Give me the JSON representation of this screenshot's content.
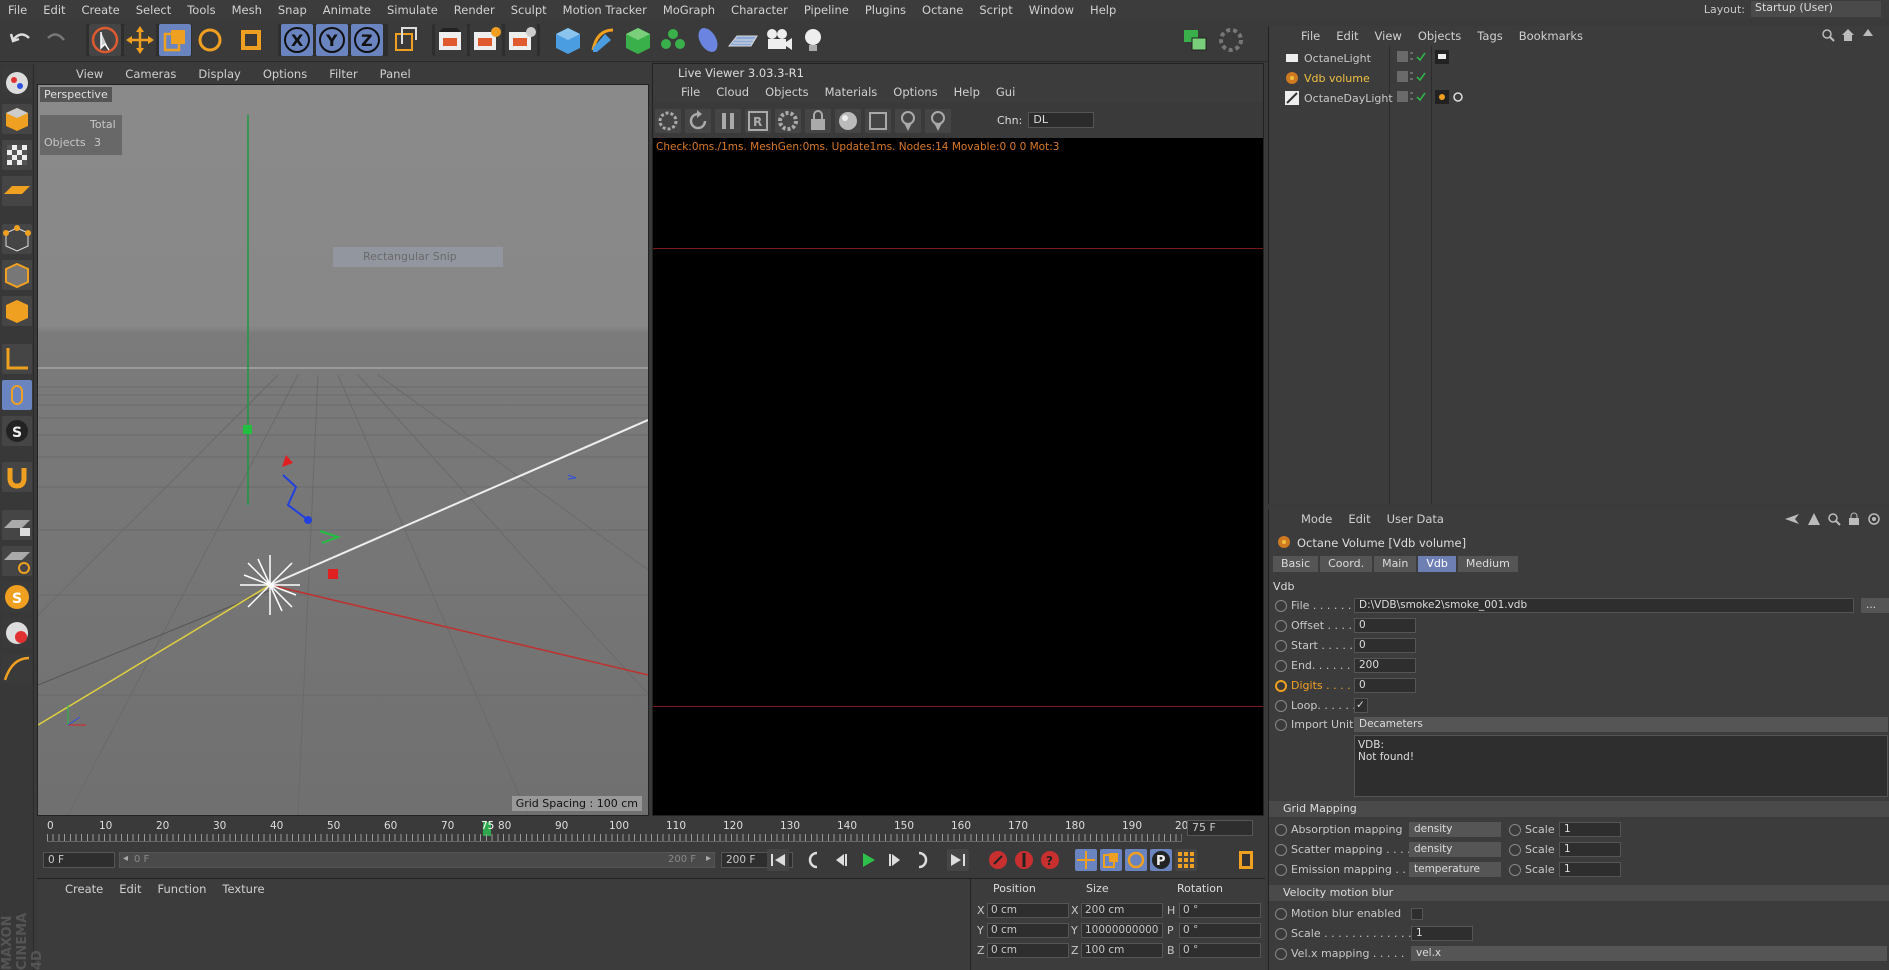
{
  "menubar": {
    "items": [
      "File",
      "Edit",
      "Create",
      "Select",
      "Tools",
      "Mesh",
      "Snap",
      "Animate",
      "Simulate",
      "Render",
      "Sculpt",
      "Motion Tracker",
      "MoGraph",
      "Character",
      "Pipeline",
      "Plugins",
      "Octane",
      "Script",
      "Window",
      "Help"
    ],
    "layout_label": "Layout:",
    "layout_value": "Startup (User)"
  },
  "viewport": {
    "menu": [
      "View",
      "Cameras",
      "Display",
      "Options",
      "Filter",
      "Panel"
    ],
    "name": "Perspective",
    "hud_total": "Total",
    "hud_objects_label": "Objects",
    "hud_objects_value": "3",
    "grid_spacing": "Grid Spacing : 100 cm",
    "snip_label": "Rectangular Snip"
  },
  "live_viewer": {
    "title": "Live Viewer 3.03.3-R1",
    "menu": [
      "File",
      "Cloud",
      "Objects",
      "Materials",
      "Options",
      "Help",
      "Gui"
    ],
    "chn_label": "Chn:",
    "chn_value": "DL",
    "status": "Check:0ms./1ms. MeshGen:0ms. Update1ms. Nodes:14 Movable:0  0 0 Mot:3"
  },
  "object_manager": {
    "menu": [
      "File",
      "Edit",
      "View",
      "Objects",
      "Tags",
      "Bookmarks"
    ],
    "objects": [
      {
        "name": "OctaneLight",
        "color": "#c8c8c8"
      },
      {
        "name": "Vdb volume",
        "color": "#f0c040"
      },
      {
        "name": "OctaneDayLight",
        "color": "#c8c8c8"
      }
    ]
  },
  "attributes": {
    "menu": [
      "Mode",
      "Edit",
      "User Data"
    ],
    "title": "Octane Volume [Vdb volume]",
    "tabs": [
      "Basic",
      "Coord.",
      "Main",
      "Vdb",
      "Medium"
    ],
    "active_tab": "Vdb",
    "section_vdb": "Vdb",
    "file_label": "File . . . . . . .",
    "file_value": "D:\\VDB\\smoke2\\smoke_001.vdb",
    "offset_label": "Offset . . . . .",
    "offset_value": "0",
    "start_label": "Start . . . . . .",
    "start_value": "0",
    "end_label": "End. . . . . . .",
    "end_value": "200",
    "digits_label": "Digits . . . . .",
    "digits_value": "0",
    "loop_label": "Loop. . . . . .",
    "loop_value": "✓",
    "import_unit_label": "Import Unit",
    "import_unit_value": "Decameters",
    "vdb_info_line1": "VDB:",
    "vdb_info_line2": "Not found!",
    "grid_mapping_label": "Grid Mapping",
    "absorption_label": "Absorption mapping",
    "absorption_value": "density",
    "scatter_label": "Scatter mapping . . . .",
    "scatter_value": "density",
    "emission_label": "Emission mapping . .",
    "emission_value": "temperature",
    "scale_label": "Scale",
    "absorption_scale": "1",
    "scatter_scale": "1",
    "emission_scale": "1",
    "velocity_label": "Velocity motion blur",
    "motion_blur_label": "Motion blur enabled",
    "vscale_label": "Scale . . . . . . . . . . . . .",
    "vscale_value": "1",
    "velx_label": "Vel.x mapping . . . . .",
    "velx_value": "vel.x"
  },
  "timeline": {
    "ticks": [
      "0",
      "10",
      "20",
      "30",
      "40",
      "50",
      "60",
      "70",
      "75",
      "80",
      "90",
      "100",
      "110",
      "120",
      "130",
      "140",
      "150",
      "160",
      "170",
      "180",
      "190",
      "200"
    ],
    "current_frame": "75 F",
    "start_field": "0 F",
    "range_start": "0 F",
    "range_end": "200 F",
    "end_field": "200 F"
  },
  "material_manager": {
    "menu": [
      "Create",
      "Edit",
      "Function",
      "Texture"
    ]
  },
  "coordinates": {
    "headers": [
      "Position",
      "Size",
      "Rotation"
    ],
    "rows": [
      {
        "axis": "X",
        "pos": "0 cm",
        "size_axis": "X",
        "size": "200 cm",
        "rot_axis": "H",
        "rot": "0 °"
      },
      {
        "axis": "Y",
        "pos": "0 cm",
        "size_axis": "Y",
        "size": "10000000000",
        "rot_axis": "P",
        "rot": "0 °"
      },
      {
        "axis": "Z",
        "pos": "0 cm",
        "size_axis": "Z",
        "size": "100 cm",
        "rot_axis": "B",
        "rot": "0 °"
      }
    ]
  },
  "brand": "MAXON CINEMA 4D"
}
